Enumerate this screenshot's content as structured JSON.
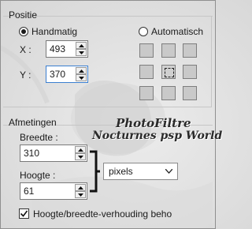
{
  "position": {
    "legend": "Positie",
    "manual_label": "Handmatig",
    "auto_label": "Automatisch",
    "x_label": "X :",
    "x_value": "493",
    "y_label": "Y :",
    "y_value": "370"
  },
  "dimensions": {
    "legend": "Afmetingen",
    "width_label": "Breedte :",
    "width_value": "310",
    "height_label": "Hoogte :",
    "height_value": "61",
    "unit_value": "pixels",
    "aspect_label": "Hoogte/breedte-verhouding beho"
  },
  "watermark": {
    "line1": "PhotoFiltre",
    "line2": "Nocturnes psp World"
  }
}
